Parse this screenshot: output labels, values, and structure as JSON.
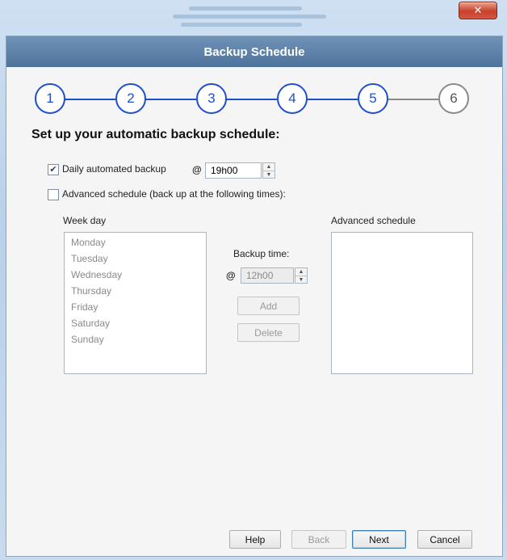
{
  "window": {
    "close_glyph": "✕"
  },
  "header": {
    "title": "Backup Schedule"
  },
  "steps": [
    {
      "label": "1",
      "active": true
    },
    {
      "label": "2",
      "active": true
    },
    {
      "label": "3",
      "active": true
    },
    {
      "label": "4",
      "active": true
    },
    {
      "label": "5",
      "active": true
    },
    {
      "label": "6",
      "active": false
    }
  ],
  "heading": "Set up your automatic backup schedule:",
  "daily": {
    "checked": true,
    "check_glyph": "✔",
    "label": "Daily automated backup",
    "at": "@",
    "time": "19h00"
  },
  "advanced": {
    "checked": false,
    "label": "Advanced schedule (back up at the following times):"
  },
  "weekday": {
    "label": "Week day",
    "items": [
      "Monday",
      "Tuesday",
      "Wednesday",
      "Thursday",
      "Friday",
      "Saturday",
      "Sunday"
    ]
  },
  "backup_time": {
    "label": "Backup time:",
    "at": "@",
    "time": "12h00"
  },
  "buttons": {
    "add": "Add",
    "delete": "Delete",
    "help": "Help",
    "back": "Back",
    "next": "Next",
    "cancel": "Cancel"
  },
  "advanced_schedule": {
    "label": "Advanced schedule",
    "items": []
  },
  "colors": {
    "accent": "#1f4fcf",
    "header_bg": "#5b7fa6",
    "inactive": "#8a8a8a"
  }
}
